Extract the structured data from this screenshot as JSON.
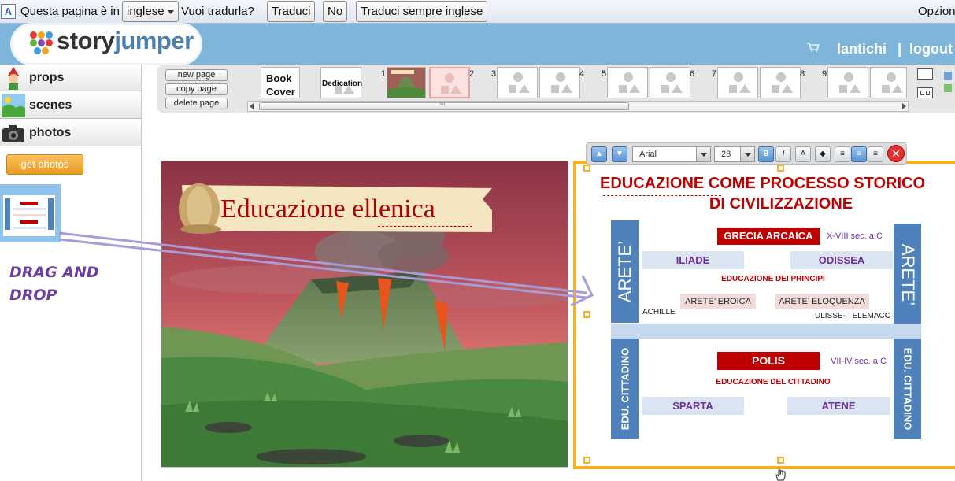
{
  "translate_bar": {
    "lead_text": "Questa pagina è in",
    "language_select": "inglese",
    "prompt_text": "Vuoi tradurla?",
    "translate_button": "Traduci",
    "no_button": "No",
    "always_button": "Traduci sempre inglese",
    "options_text": "Opzion"
  },
  "header": {
    "logo_part1": "story",
    "logo_part2": "jumper",
    "user": "lantichi",
    "separator": "|",
    "logout": "logout"
  },
  "left_panel": {
    "tabs": [
      {
        "label": "props",
        "icon": "elf-icon"
      },
      {
        "label": "scenes",
        "icon": "landscape-icon"
      },
      {
        "label": "photos",
        "icon": "camera-icon"
      }
    ],
    "get_photos": "get photos",
    "annotation": "DRAG AND DROP"
  },
  "page_toolbar": {
    "new_page": "new page",
    "copy_page": "copy page",
    "delete_page": "delete page",
    "cover_label": "Book Cover",
    "dedication_label": "Dedication",
    "page_numbers": [
      "1",
      "2",
      "3",
      "4",
      "5",
      "6",
      "7",
      "8",
      "9"
    ],
    "scroll_grip": "IIII"
  },
  "format_toolbar": {
    "font": "Arial",
    "size": "28",
    "bold": "B",
    "italic": "I",
    "close": "✕"
  },
  "left_page": {
    "title": "Educazione ellenica"
  },
  "scheme": {
    "title_line1": "EDUCAZIONE COME PROCESSO STORICO",
    "title_line2": "DI CIVILIZZAZIONE",
    "arete_left": "ARETE’",
    "arete_right": "ARETE’",
    "grecia": "GRECIA ARCAICA",
    "grecia_date": "X-VIII sec. a.C",
    "iliade": "ILIADE",
    "odissea": "ODISSEA",
    "principi": "EDUCAZIONE DEI PRINCIPI",
    "arete_eroica": "ARETE’ EROICA",
    "arete_eloquenza": "ARETE’ ELOQUENZA",
    "achille": "ACHILLE",
    "ulisse": "ULISSE- TELEMACO",
    "cittadino_left": "EDU. CITTADINO",
    "cittadino_right": "EDU. CITTADINO",
    "polis": "POLIS",
    "polis_date": "VII-IV sec. a.C",
    "educ_cittadino": "EDUCAZIONE DEL CITTADINO",
    "sparta": "SPARTA",
    "atene": "ATENE"
  }
}
